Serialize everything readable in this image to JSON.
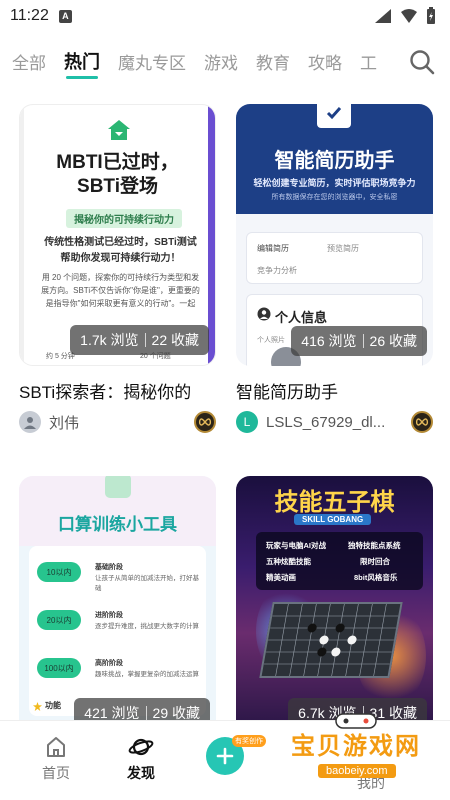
{
  "status_bar": {
    "time": "11:22",
    "notice_letter": "A"
  },
  "tabs": [
    {
      "label": "全部",
      "active": false
    },
    {
      "label": "热门",
      "active": true
    },
    {
      "label": "魔丸专区",
      "active": false
    },
    {
      "label": "游戏",
      "active": false
    },
    {
      "label": "教育",
      "active": false
    },
    {
      "label": "攻略",
      "active": false
    },
    {
      "label": "工",
      "active": false
    }
  ],
  "search": {
    "icon": "search-icon"
  },
  "cards": [
    {
      "title": "SBTi探索者：揭秘你的",
      "author": "刘伟",
      "views": "1.7k 浏览",
      "favorites": "22 收藏",
      "thumb": {
        "heading_line1": "MBTI已过时，",
        "heading_line2": "SBTi登场",
        "tag": "揭秘你的可持续行动力",
        "body": "传统性格测试已经过时，SBTi测试帮助你发现可持续行动力！",
        "small": "用 20 个问题，探索你的可持续行为类型和发展方向。SBTi不仅告诉你\"你是谁\"，更重要的是指导你\"如何采取更有意义的行动\"。一起",
        "footer_left": "约 5 分钟",
        "footer_right": "20 个问题"
      }
    },
    {
      "title": "智能简历助手",
      "author": "LSLS_67929_dl...",
      "author_initial": "L",
      "views": "416 浏览",
      "favorites": "26 收藏",
      "thumb": {
        "heading": "智能简历助手",
        "sub": "轻松创建专业简历，实时评估职场竞争力",
        "sub2": "所有数据保存在您的浏览器中，安全私密",
        "menu_edit": "编辑简历",
        "menu_preview": "预览简历",
        "menu_analysis": "竞争力分析",
        "info_title": "个人信息",
        "info_label": "个人照片"
      }
    },
    {
      "title": "",
      "views": "421 浏览",
      "favorites": "29 收藏",
      "thumb": {
        "heading": "口算训练小工具",
        "levels": [
          {
            "badge": "10以内",
            "name": "基础阶段",
            "desc": "让孩子从简单的加减法开始，打好基础"
          },
          {
            "badge": "20以内",
            "name": "进阶阶段",
            "desc": "逐步提升难度，挑战更大数字的计算"
          },
          {
            "badge": "100以内",
            "name": "高阶阶段",
            "desc": "趣味挑战，掌握更复杂的加减法运算"
          }
        ],
        "feature": "功能"
      }
    },
    {
      "title": "",
      "views": "6.7k 浏览",
      "favorites": "31 收藏",
      "thumb": {
        "heading": "技能五子棋",
        "sub": "SKILL GOBANG",
        "features": [
          "玩家与电脑AI对战",
          "独特技能点系统",
          "五种炫酷技能",
          "限时回合",
          "精美动画",
          "8bit风格音乐"
        ]
      }
    }
  ],
  "bottom_nav": {
    "home": "首页",
    "discover": "发现",
    "create_tag": "有奖创作",
    "mine": "我的"
  },
  "watermark": {
    "title": "宝贝游戏网",
    "url": "baobeiy.com"
  },
  "colors": {
    "accent": "#1fbfa8",
    "create": "#26c6b4"
  }
}
